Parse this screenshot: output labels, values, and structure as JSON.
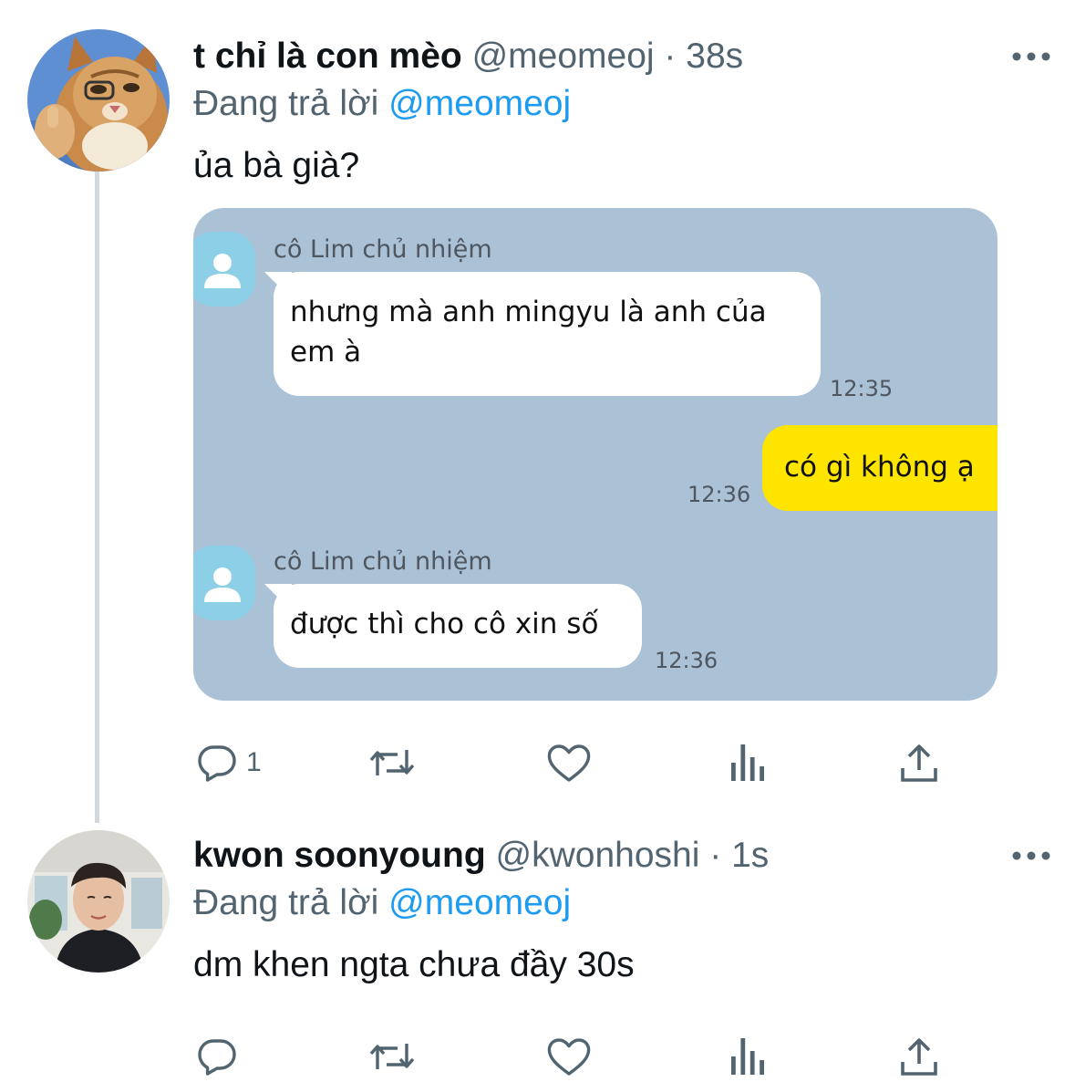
{
  "tweets": [
    {
      "display_name": "t chỉ là con mèo",
      "handle": "@meomeoj",
      "separator": "·",
      "time": "38s",
      "reply_prefix": "Đang trả lời",
      "reply_to": "@meomeoj",
      "text": "ủa bà già?",
      "actions": {
        "reply_count": "1",
        "retweet_count": "",
        "like_count": ""
      },
      "attached_image": {
        "messages": [
          {
            "sender": "cô Lim chủ nhiệm",
            "lines": [
              "nhưng mà anh mingyu là anh của",
              "em à"
            ],
            "time": "12:35"
          },
          {
            "sender": "me",
            "lines": [
              "có gì không ạ"
            ],
            "time": "12:36"
          },
          {
            "sender": "cô Lim chủ nhiệm",
            "lines": [
              "được thì cho cô xin số"
            ],
            "time": "12:36"
          }
        ]
      }
    },
    {
      "display_name": "kwon soonyoung",
      "handle": "@kwonhoshi",
      "separator": "·",
      "time": "1s",
      "reply_prefix": "Đang trả lời",
      "reply_to": "@meomeoj",
      "text": "dm khen ngta chưa đầy 30s",
      "actions": {
        "reply_count": "",
        "retweet_count": "",
        "like_count": ""
      }
    }
  ],
  "icons": {
    "more": "more-dots-icon",
    "reply": "reply-bubble-icon",
    "retweet": "retweet-icon",
    "like": "heart-icon",
    "analytics": "analytics-bars-icon",
    "share": "share-upload-icon",
    "chat_avatar": "default-user-icon"
  },
  "colors": {
    "link": "#1d9bf0",
    "muted": "#536471",
    "thread_line": "#cfd9de",
    "chat_background": "#abc1d6",
    "chat_my_bubble": "#fee500"
  }
}
